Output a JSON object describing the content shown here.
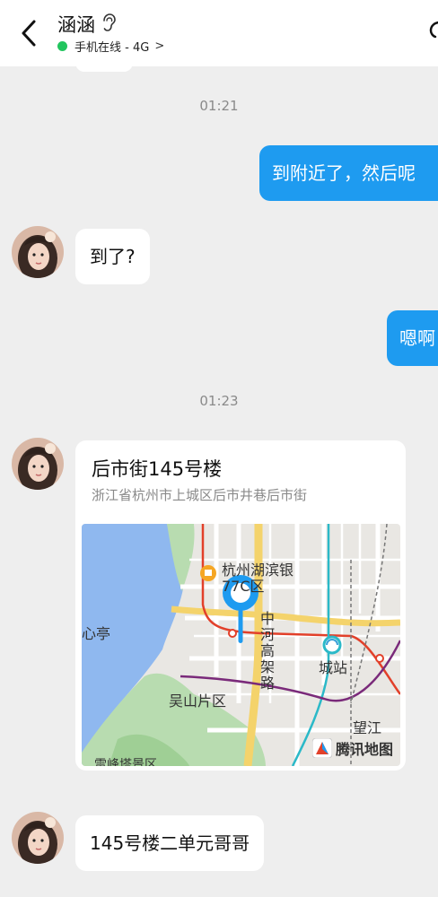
{
  "header": {
    "title": "涵涵",
    "status": "手机在线 - 4G",
    "status_chevron": ">"
  },
  "messages": {
    "time1": "01:21",
    "msg_out1": "到附近了，然后呢",
    "msg_in1": "到了?",
    "msg_out2": "嗯啊",
    "time2": "01:23",
    "msg_in3": "145号楼二单元哥哥"
  },
  "location": {
    "title": "后市街145号楼",
    "address": "浙江省杭州市上城区后市井巷后市街",
    "map": {
      "labels": {
        "bank": "杭州湖滨银",
        "bank2": "77C区",
        "pavilion": "心亭",
        "road_v": [
          "中",
          "河",
          "高",
          "架",
          "路"
        ],
        "station": "城站",
        "wushan": "吴山片区",
        "wangjiang": "望江",
        "scenic": "雷峰塔景区",
        "brand": "腾讯地图"
      }
    }
  },
  "colors": {
    "accent": "#1e9bf0",
    "online": "#22c55e"
  }
}
